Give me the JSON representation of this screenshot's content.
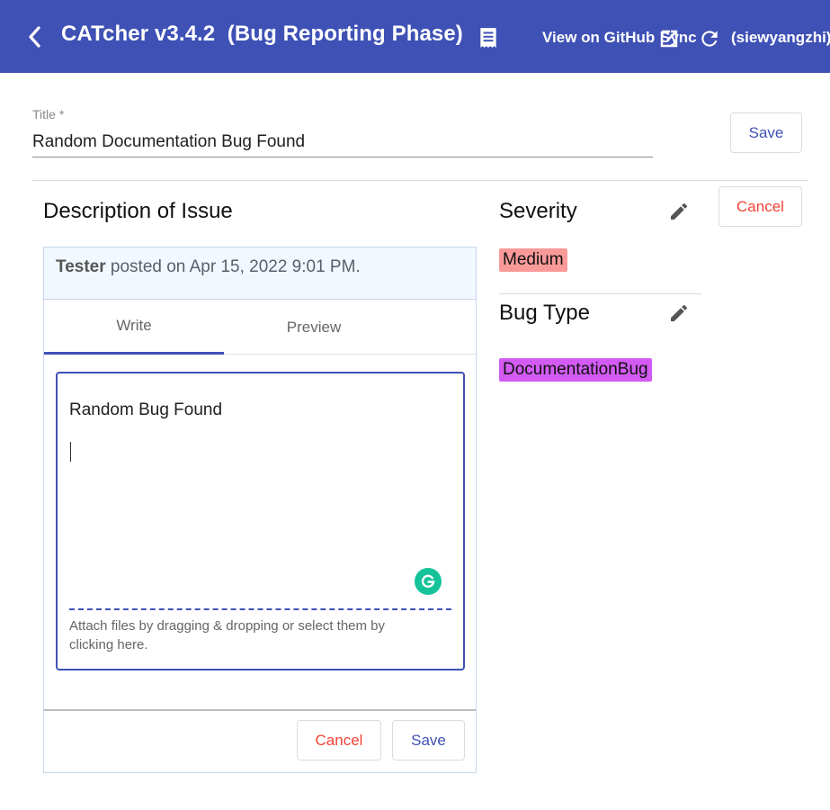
{
  "app": {
    "title": "CATcher v3.4.2  (Bug Reporting Phase)",
    "github_link": "View on GitHub",
    "sync_label": "Sync",
    "user": "(siewyangzhi)",
    "header_color": "#3f51b5"
  },
  "icons": {
    "back": "chevron-left-icon",
    "document": "document-icon",
    "sync": "open-in-new-icon",
    "refresh": "refresh-icon",
    "edit": "pencil-icon",
    "grammarly": "grammarly-icon"
  },
  "title_field": {
    "label": "Title *",
    "value": "Random Documentation Bug Found"
  },
  "top_actions": {
    "save_label": "Save",
    "cancel_label": "Cancel"
  },
  "description": {
    "heading": "Description of Issue",
    "author": "Tester",
    "posted_text": " posted on Apr 15, 2022 9:01 PM.",
    "tabs": [
      {
        "label": "Write",
        "active": true
      },
      {
        "label": "Preview",
        "active": false
      }
    ],
    "editor_text": "Random Bug Found",
    "attach_hint": "Attach files by dragging & dropping or select them by clicking here.",
    "cancel_label": "Cancel",
    "save_label": "Save"
  },
  "severity": {
    "heading": "Severity",
    "value": "Medium",
    "color": "#f99a99"
  },
  "bug_type": {
    "heading": "Bug Type",
    "value": "DocumentationBug",
    "color": "#d35bf3"
  }
}
